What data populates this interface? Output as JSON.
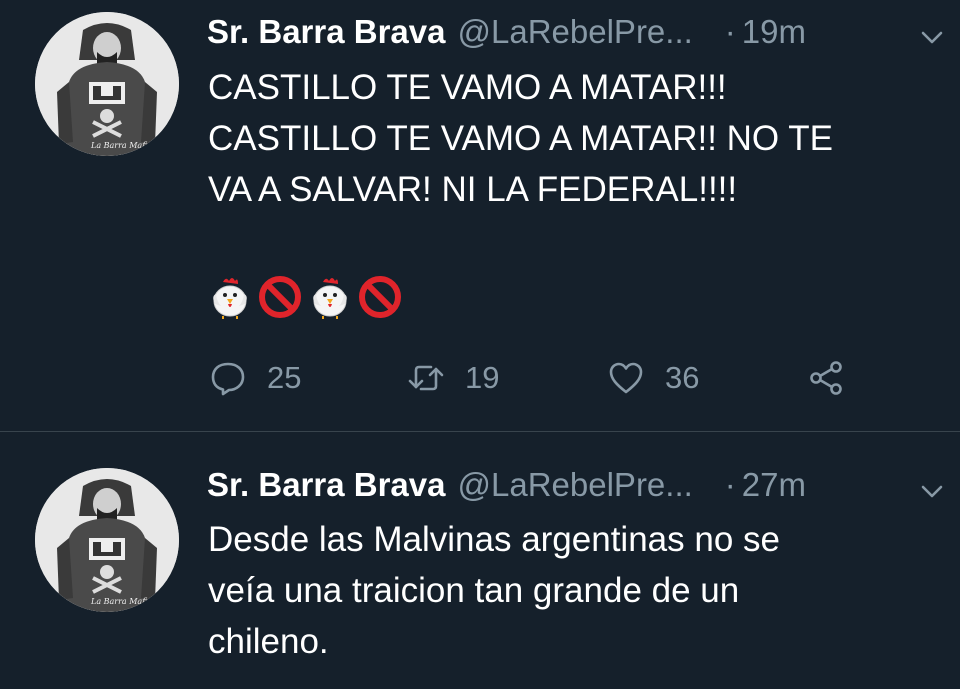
{
  "tweets": [
    {
      "name": "Sr. Barra Brava",
      "handle": "@LaRebelPre...",
      "dot": "·",
      "time": "19m",
      "lines": [
        "CASTILLO TE VAMO A MATAR!!!",
        "CASTILLO TE VAMO A MATAR!! NO TE",
        "VA A SALVAR! NI LA FEDERAL!!!!"
      ],
      "emojis": [
        "chicken",
        "prohibited",
        "chicken",
        "prohibited"
      ],
      "replies": "25",
      "retweets": "19",
      "likes": "36"
    },
    {
      "name": "Sr. Barra Brava",
      "handle": "@LaRebelPre...",
      "dot": "·",
      "time": "27m",
      "lines": [
        "Desde las Malvinas argentinas no se",
        "veía una traicion tan grande de un",
        "chileno."
      ]
    }
  ],
  "avatar_caption": "La Barra Mafia",
  "icons": {
    "reply": "reply-icon",
    "retweet": "retweet-icon",
    "like": "heart-icon",
    "share": "share-icon",
    "menu": "chevron-down-icon"
  },
  "colors": {
    "background": "#15202b",
    "secondary_text": "#8899a6",
    "divider": "#38444d",
    "prohibited_red": "#e0242b"
  }
}
